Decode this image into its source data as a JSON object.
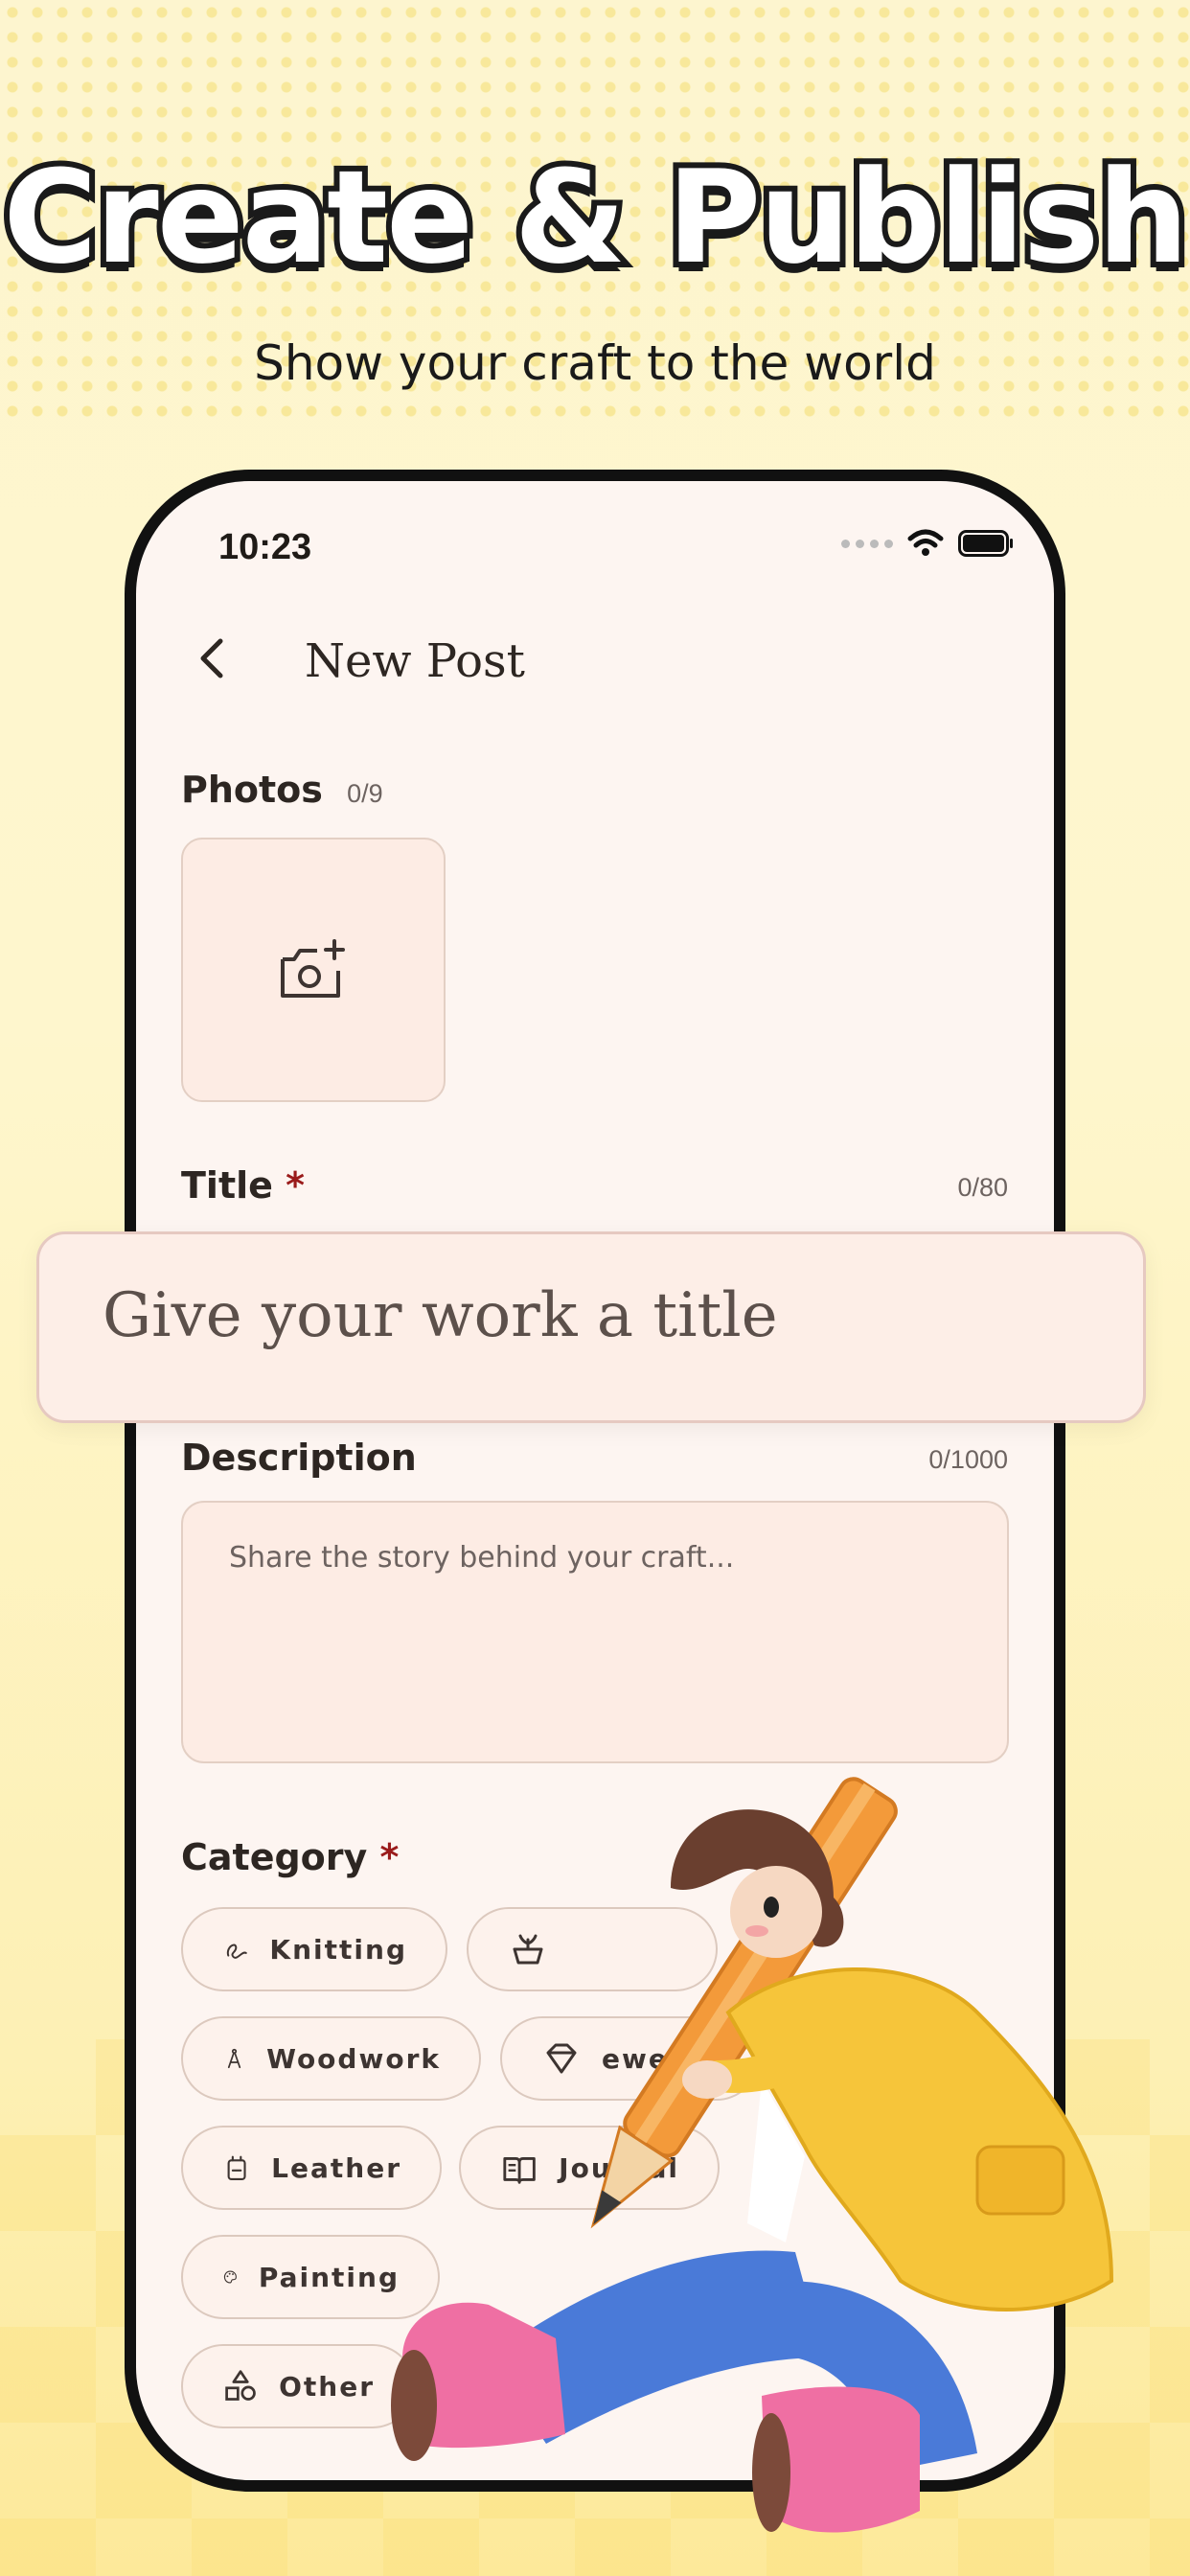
{
  "promo": {
    "headline": "Create & Publish",
    "subheadline": "Show your craft to the world"
  },
  "status_bar": {
    "time": "10:23"
  },
  "nav": {
    "title": "New Post"
  },
  "photos": {
    "label": "Photos",
    "counter": "0/9"
  },
  "title_field": {
    "label": "Title",
    "required_mark": "*",
    "counter": "0/80",
    "placeholder": "Give your work a title"
  },
  "description": {
    "label": "Description",
    "counter": "0/1000",
    "placeholder": "Share the story behind your craft..."
  },
  "category": {
    "label": "Category",
    "required_mark": "*",
    "chips": [
      {
        "label": "Knitting",
        "icon": "yarn-icon"
      },
      {
        "label": "",
        "icon": "plant-pot-icon"
      },
      {
        "label": "Woodwork",
        "icon": "compass-icon"
      },
      {
        "label": "ewelry",
        "icon": "gem-icon"
      },
      {
        "label": "Leather",
        "icon": "bag-icon"
      },
      {
        "label": "Journal",
        "icon": "book-icon"
      },
      {
        "label": "Painting",
        "icon": "palette-icon"
      },
      {
        "label": "Other",
        "icon": "shapes-icon"
      }
    ]
  },
  "colors": {
    "accent_required": "#9a1b1b",
    "screen_bg": "#fdf5f1",
    "field_bg": "#fdece4",
    "promo_bg": "#fdf5cf"
  }
}
